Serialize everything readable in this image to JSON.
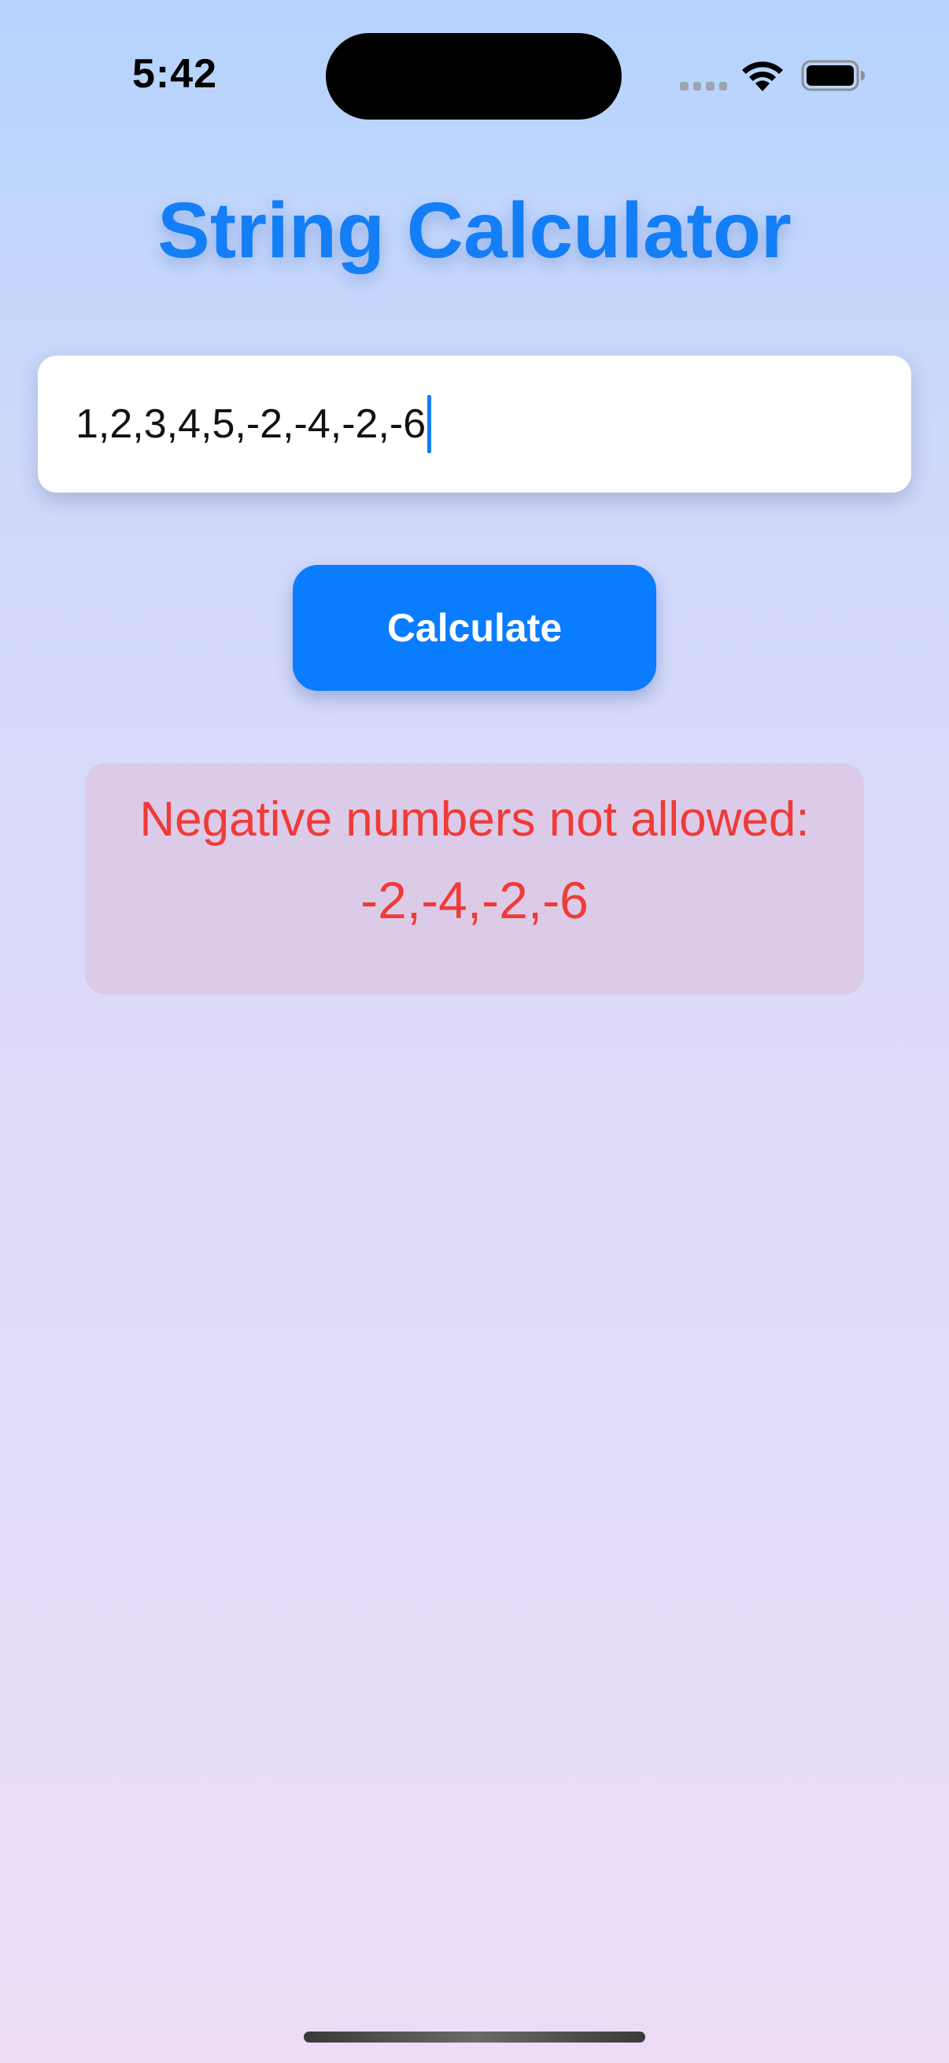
{
  "status_bar": {
    "time": "5:42",
    "icons": [
      "cellular-dots-icon",
      "wifi-icon",
      "battery-icon"
    ]
  },
  "title": "String Calculator",
  "input": {
    "value": "1,2,3,4,5,-2,-4,-2,-6",
    "placeholder": ""
  },
  "button": {
    "label": "Calculate"
  },
  "error": {
    "line1": "Negative numbers not allowed:",
    "line2": "-2,-4,-2,-6"
  },
  "colors": {
    "accent": "#137ef6",
    "button": "#0a7cff",
    "error_text": "#ef3b38",
    "error_bg": "#dcc8e4"
  }
}
